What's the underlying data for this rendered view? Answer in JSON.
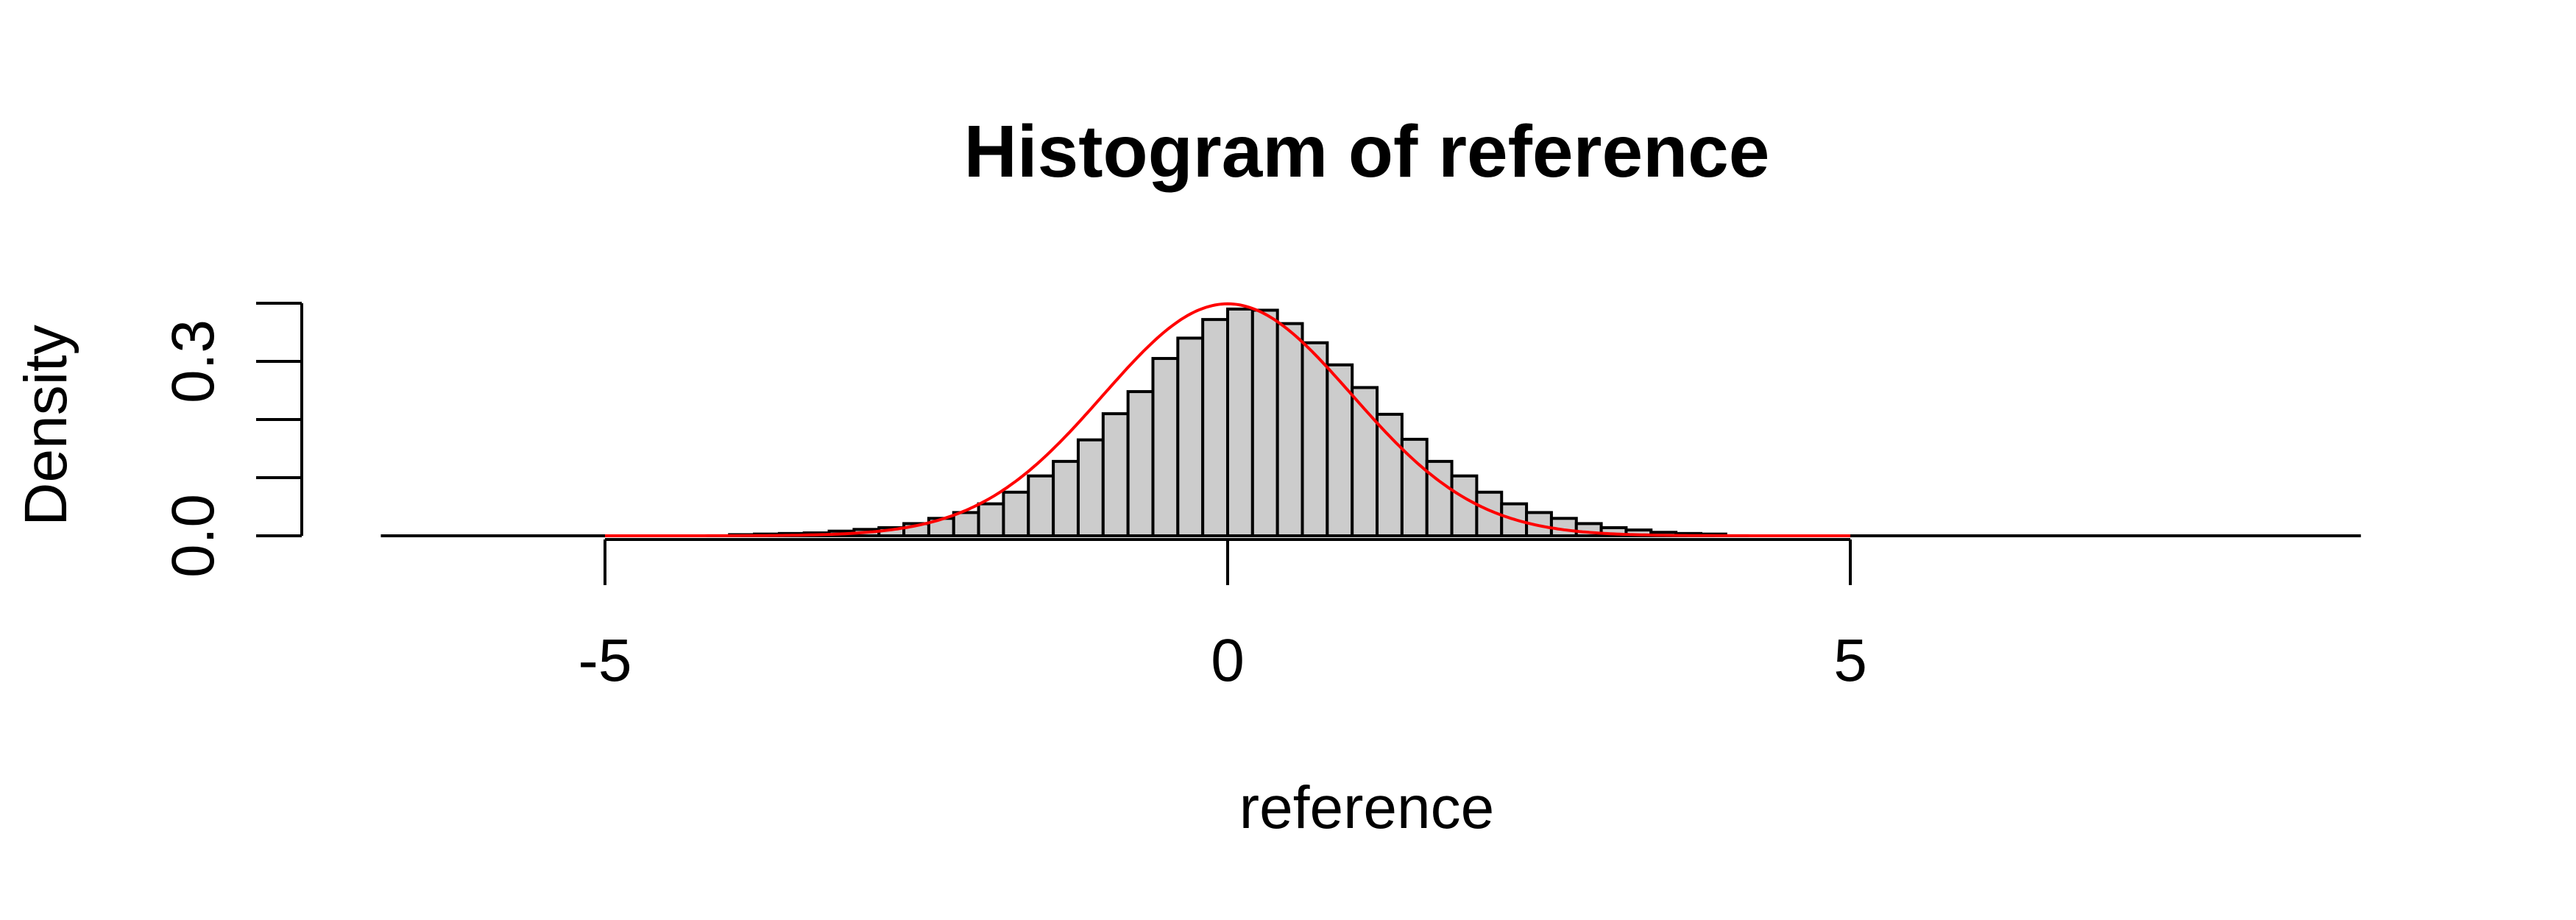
{
  "chart_data": {
    "type": "bar",
    "title": "Histogram of reference",
    "xlabel": "reference",
    "ylabel": "Density",
    "xlim": [
      -6.8,
      9.1
    ],
    "ylim": [
      0,
      0.4
    ],
    "x_ticks": [
      -5,
      0,
      5
    ],
    "x_tick_labels": [
      "-5",
      "0",
      "5"
    ],
    "y_ticks": [
      0.0,
      0.1,
      0.2,
      0.3,
      0.4
    ],
    "y_tick_labels": [
      "0.0",
      "0.3"
    ],
    "bin_width": 0.2,
    "series": [
      {
        "bin_starts": [
          -4.0,
          -3.8,
          -3.6,
          -3.4,
          -3.2,
          -3.0,
          -2.8,
          -2.6,
          -2.4,
          -2.2,
          -2.0,
          -1.8,
          -1.6,
          -1.4,
          -1.2,
          -1.0,
          -0.8,
          -0.6,
          -0.4,
          -0.2,
          0.0,
          0.2,
          0.4,
          0.6,
          0.8,
          1.0,
          1.2,
          1.4,
          1.6,
          1.8,
          2.0,
          2.2,
          2.4,
          2.6,
          2.8,
          3.0,
          3.2,
          3.4,
          3.6,
          3.8
        ],
        "density": [
          0.002,
          0.003,
          0.004,
          0.005,
          0.008,
          0.011,
          0.014,
          0.021,
          0.03,
          0.04,
          0.055,
          0.075,
          0.103,
          0.128,
          0.165,
          0.21,
          0.248,
          0.305,
          0.34,
          0.372,
          0.39,
          0.388,
          0.365,
          0.332,
          0.294,
          0.255,
          0.209,
          0.166,
          0.128,
          0.103,
          0.075,
          0.055,
          0.04,
          0.03,
          0.021,
          0.014,
          0.01,
          0.006,
          0.004,
          0.003
        ]
      }
    ],
    "overlay_curve": {
      "type": "line",
      "color": "#ff0000",
      "x_range": [
        -5,
        5
      ],
      "mean": 0,
      "sd": 1
    },
    "colors": {
      "bar_fill": "#cccccc",
      "bar_stroke": "#000000",
      "curve": "#ff0000"
    }
  }
}
